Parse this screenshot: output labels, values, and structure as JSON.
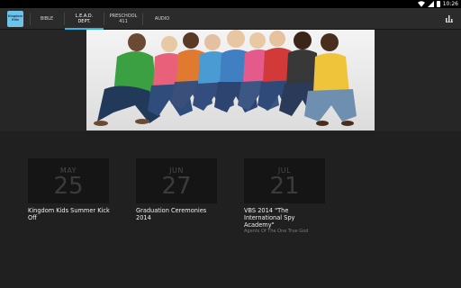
{
  "status_bar": {
    "time": "10:26"
  },
  "app": {
    "logo_text": "Kingdom\nKids"
  },
  "tabs": [
    {
      "label": "BIBLE",
      "active": false
    },
    {
      "label": "L.E.A.D.\nDEPT.",
      "active": true
    },
    {
      "label": "PRESCHOOL\n411",
      "active": false
    },
    {
      "label": "AUDIO",
      "active": false
    }
  ],
  "events": [
    {
      "month": "MAY",
      "day": "25",
      "title": "Kingdom Kids Summer Kick Off",
      "subtitle": ""
    },
    {
      "month": "JUN",
      "day": "27",
      "title": "Graduation Ceremonies 2014",
      "subtitle": ""
    },
    {
      "month": "JUL",
      "day": "21",
      "title": "VBS 2014 \"The International Spy Academy\"",
      "subtitle": "Agents Of The One True God"
    }
  ],
  "colors": {
    "accent": "#2fb4e3",
    "background": "#232323",
    "appbar": "#2b2b2b"
  }
}
